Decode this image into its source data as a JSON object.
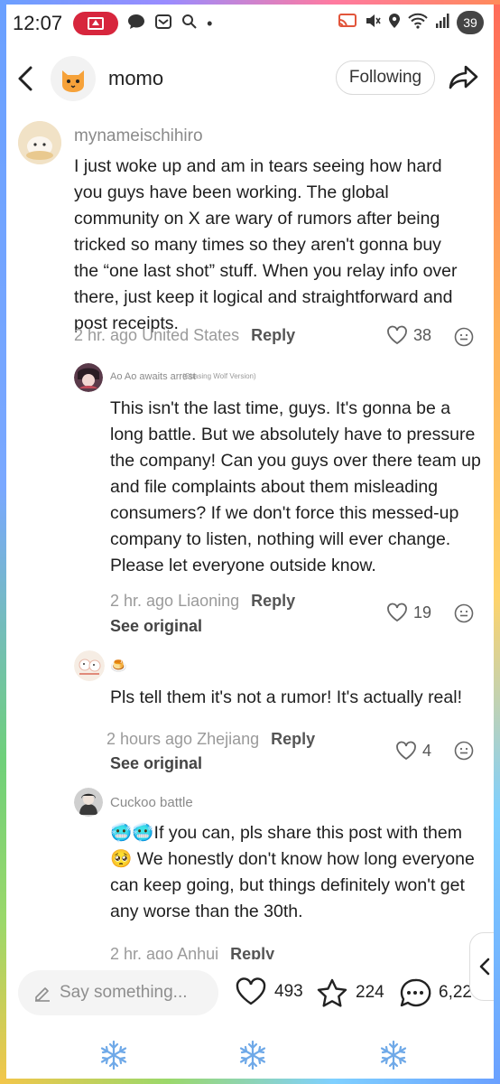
{
  "status_bar": {
    "time": "12:07",
    "battery": "39",
    "network": "6E"
  },
  "header": {
    "channel_name": "momo",
    "follow_label": "Following"
  },
  "comments": [
    {
      "username": "mynameischihiro",
      "text": "I just woke up and am in tears seeing how hard you guys have been working. The global community on X are wary of rumors after being tricked so many times so they aren't gonna buy the “one last shot” stuff. When you relay info over there, just keep it logical and straightforward and post receipts.",
      "time": "2 hr. ago",
      "location": "United States",
      "reply_label": "Reply",
      "likes": "38"
    },
    {
      "username": "Ao Ao awaits arrest",
      "tag": "(Chasing Wolf Version)",
      "text": "This isn't the last time, guys. It's gonna be a long battle. But we absolutely have to pressure the company! Can you guys over there team up and file complaints about them misleading consumers? If we don't force this messed-up company to listen, nothing will ever change. Please let everyone outside know.",
      "time": "2 hr. ago",
      "location": "Liaoning",
      "reply_label": "Reply",
      "see_original": "See original",
      "likes": "19"
    },
    {
      "username": "🍮",
      "text": "Pls tell them it's not a rumor! It's actually real!",
      "time": "2 hours ago",
      "location": "Zhejiang",
      "reply_label": "Reply",
      "see_original": "See original",
      "likes": "4"
    },
    {
      "username": "Cuckoo battle",
      "text": "🥶🥶If you can, pls share this post with them 🥺 We honestly don't know how long everyone can keep going, but things definitely won't get any worse than the 30th.",
      "time": "2 hr. ago",
      "location": "Anhui",
      "reply_label": "Reply"
    }
  ],
  "bottom_bar": {
    "input_placeholder": "Say something...",
    "likes": "493",
    "favorites": "224",
    "comments": "6,22"
  },
  "icons": {
    "back": "chevron-left-icon",
    "share": "share-arrow-icon",
    "like": "heart-icon",
    "favorite": "star-icon",
    "comment": "chat-bubble-icon",
    "react": "smiley-icon",
    "nav": "snowflake-icon"
  },
  "colors": {
    "record_pill": "#d7263d",
    "meta_gray": "#9a9a9a"
  }
}
